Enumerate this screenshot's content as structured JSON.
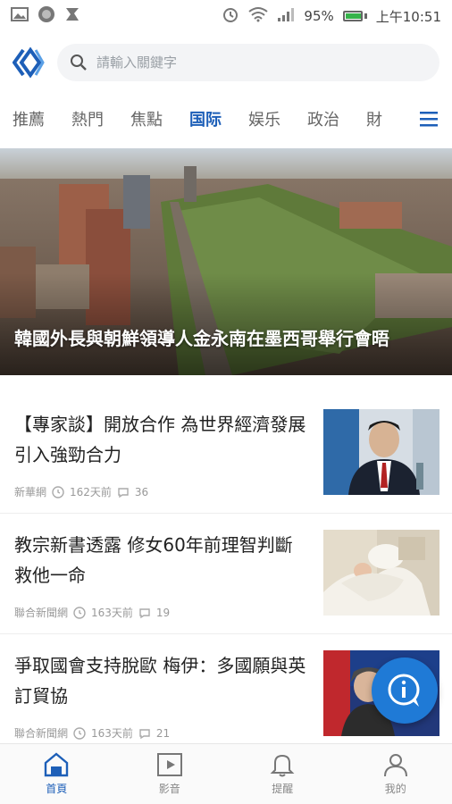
{
  "status": {
    "battery": "95%",
    "time": "上午10:51",
    "battery_level": 0.95,
    "battery_color": "#36b34a"
  },
  "search": {
    "placeholder": "請輸入關鍵字"
  },
  "tabs": [
    "推薦",
    "熱門",
    "焦點",
    "国际",
    "娱乐",
    "政治",
    "財"
  ],
  "active_tab": "国际",
  "hero": {
    "title": "韓國外長與朝鮮領導人金永南在墨西哥舉行會晤"
  },
  "feed": [
    {
      "title": "【專家談】開放合作 為世界經濟發展引入強勁合力",
      "source": "新華網",
      "time": "162天前",
      "comments": "36"
    },
    {
      "title": "教宗新書透露 修女60年前理智判斷救他一命",
      "source": "聯合新聞網",
      "time": "163天前",
      "comments": "19"
    },
    {
      "title": "爭取國會支持脫歐 梅伊：多國願與英訂貿協",
      "source": "聯合新聞網",
      "time": "163天前",
      "comments": "21"
    }
  ],
  "bottom_nav": [
    {
      "label": "首頁",
      "icon": "home-icon"
    },
    {
      "label": "影音",
      "icon": "video-icon"
    },
    {
      "label": "提醒",
      "icon": "bell-icon"
    },
    {
      "label": "我的",
      "icon": "user-icon"
    }
  ],
  "colors": {
    "accent": "#1d5fb8",
    "fab": "#1f7ad6"
  }
}
